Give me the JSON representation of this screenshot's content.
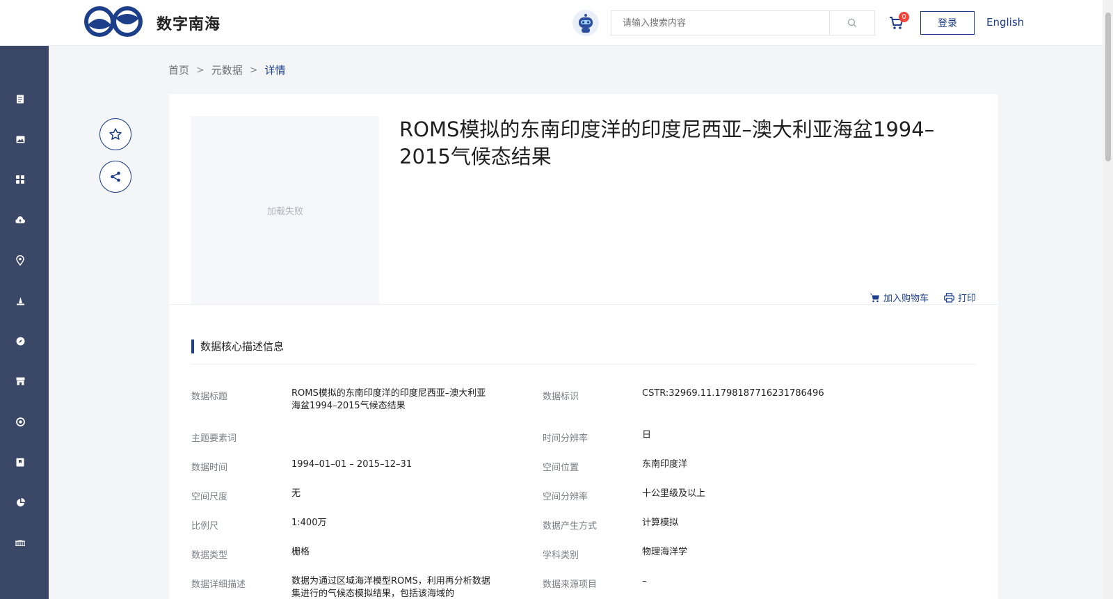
{
  "header": {
    "brand": "数字南海",
    "search_placeholder": "请输入搜索内容",
    "cart_count": "0",
    "login_label": "登录",
    "language_label": "English"
  },
  "sidebar": {
    "icons": [
      "document-icon",
      "image-icon",
      "grid-icon",
      "cloud-upload-icon",
      "location-icon",
      "tower-icon",
      "compass-icon",
      "storefront-icon",
      "target-icon",
      "bookmark-icon",
      "pie-chart-icon",
      "bridge-icon"
    ]
  },
  "breadcrumb": {
    "home": "首页",
    "metadata": "元数据",
    "current": "详情"
  },
  "detail": {
    "thumbnail_text": "加载失败",
    "title": "ROMS模拟的东南印度洋的印度尼西亚–澳大利亚海盆1994–2015气候态结果",
    "add_to_cart": "加入购物车",
    "print": "打印",
    "section_title": "数据核心描述信息"
  },
  "fields": {
    "data_title_label": "数据标题",
    "data_title_value": "ROMS模拟的东南印度洋的印度尼西亚–澳大利亚海盆1994–2015气候态结果",
    "data_id_label": "数据标识",
    "data_id_value": "CSTR:32969.11.1798187716231786496",
    "keywords_label": "主题要素词",
    "keywords_value": "",
    "time_res_label": "时间分辨率",
    "time_res_value": "日",
    "data_time_label": "数据时间",
    "data_time_value": "1994–01–01 – 2015–12–31",
    "location_label": "空间位置",
    "location_value": "东南印度洋",
    "spatial_scale_label": "空间尺度",
    "spatial_scale_value": "无",
    "spatial_res_label": "空间分辨率",
    "spatial_res_value": "十公里级及以上",
    "scale_label": "比例尺",
    "scale_value": "1:400万",
    "production_label": "数据产生方式",
    "production_value": "计算模拟",
    "data_type_label": "数据类型",
    "data_type_value": "栅格",
    "discipline_label": "学科类别",
    "discipline_value": "物理海洋学",
    "description_label": "数据详细描述",
    "description_value": "数据为通过区域海洋模型ROMS，利用再分析数据集进行的气候态模拟结果，包括该海域的",
    "source_project_label": "数据来源项目",
    "source_project_value": "–"
  }
}
